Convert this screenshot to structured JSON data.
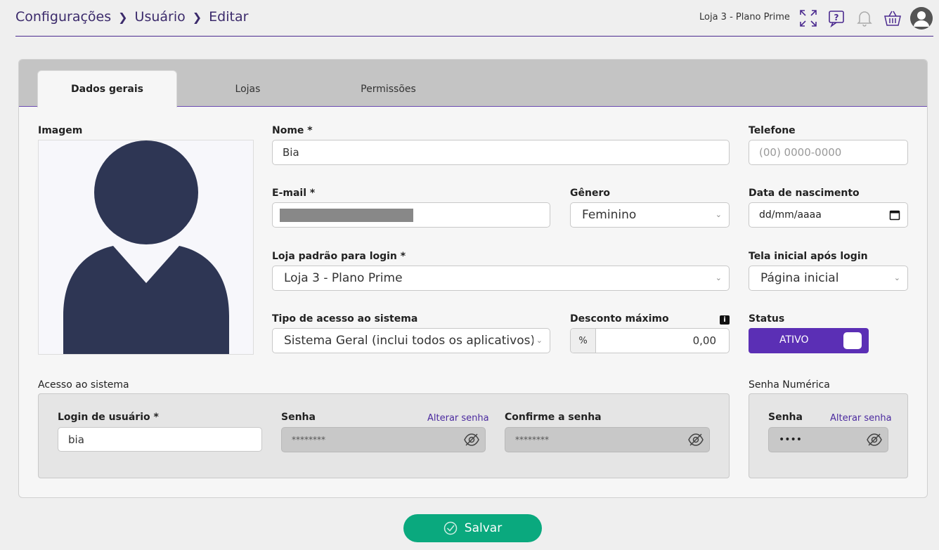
{
  "breadcrumb": [
    "Configurações",
    "Usuário",
    "Editar"
  ],
  "header": {
    "store": "Loja 3 - Plano Prime"
  },
  "tabs": [
    "Dados gerais",
    "Lojas",
    "Permissões"
  ],
  "form": {
    "image_label": "Imagem",
    "name_label": "Nome *",
    "name_value": "Bia",
    "phone_label": "Telefone",
    "phone_placeholder": "(00) 0000-0000",
    "email_label": "E-mail *",
    "gender_label": "Gênero",
    "gender_value": "Feminino",
    "birth_label": "Data de nascimento",
    "birth_placeholder": "dd/mm/aaaa",
    "store_login_label": "Loja padrão para login *",
    "store_login_value": "Loja 3 - Plano Prime",
    "home_label": "Tela inicial após login",
    "home_value": "Página inicial",
    "access_type_label": "Tipo de acesso ao sistema",
    "access_type_value": "Sistema Geral (inclui todos os aplicativos)",
    "discount_label": "Desconto máximo",
    "discount_prefix": "%",
    "discount_value": "0,00",
    "status_label": "Status",
    "status_value": "ATIVO"
  },
  "access": {
    "section_label": "Acesso ao sistema",
    "login_label": "Login de usuário *",
    "login_value": "bia",
    "password_label": "Senha",
    "change_password": "Alterar senha",
    "password_value": "********",
    "confirm_label": "Confirme a senha",
    "confirm_value": "********"
  },
  "numeric": {
    "section_label": "Senha Numérica",
    "password_label": "Senha",
    "change_password": "Alterar senha",
    "password_value": "••••"
  },
  "save_label": "Salvar",
  "colors": {
    "accent": "#5b2fb5",
    "save": "#0aa97e",
    "avatar": "#2e3654"
  }
}
